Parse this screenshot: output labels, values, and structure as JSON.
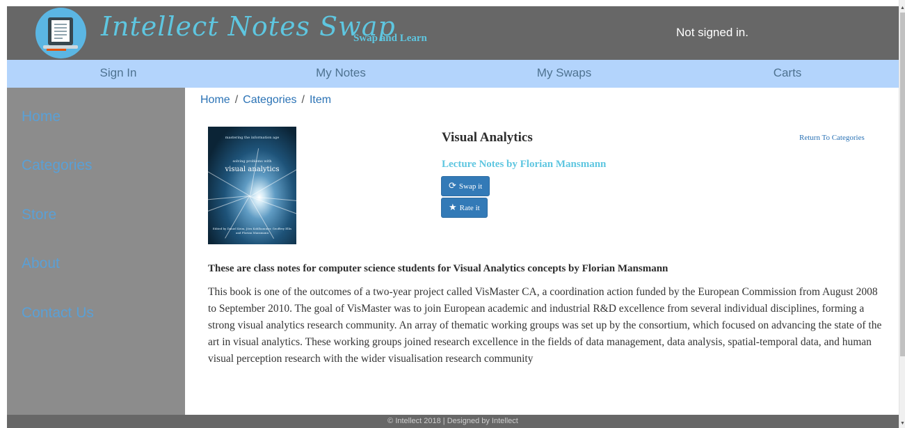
{
  "header": {
    "brand": "Intellect Notes Swap",
    "tagline": "Swap and Learn",
    "signin_status": "Not signed in."
  },
  "nav": {
    "items": [
      {
        "label": "Sign In"
      },
      {
        "label": "My Notes"
      },
      {
        "label": "My Swaps"
      },
      {
        "label": "Carts"
      }
    ]
  },
  "sidebar": {
    "items": [
      {
        "label": "Home"
      },
      {
        "label": "Categories"
      },
      {
        "label": "Store"
      },
      {
        "label": "About"
      },
      {
        "label": "Contact Us"
      }
    ]
  },
  "breadcrumb": {
    "items": [
      "Home",
      "Categories",
      "Item"
    ],
    "separator": "/"
  },
  "cover": {
    "top_text": "mastering the information age",
    "subtitle": "solving problems with",
    "title": "visual analytics",
    "editors": "Edited by Daniel Keim, Jörn Kohlhammer, Geoffrey Ellis and Florian Mansmann"
  },
  "item": {
    "title": "Visual Analytics",
    "return_label": "Return To Categories",
    "author": "Lecture Notes by Florian Mansmann",
    "swap_label": "Swap it",
    "swap_icon": "refresh-icon",
    "rate_label": "Rate it",
    "rate_icon": "star-icon"
  },
  "description": {
    "heading": "These are class notes for computer science students for Visual Analytics concepts by Florian Mansmann",
    "body": "This book is one of the outcomes of a two-year project called VisMaster CA, a coordination action funded by the European Commission from August 2008 to September 2010. The goal of VisMaster was to join European academic and industrial R&D excellence from several individual disciplines, forming a strong visual analytics research community. An array of thematic working groups was set up by the consortium, which focused on advancing the state of the art in visual analytics. These working groups joined research excellence in the fields of data management, data analysis, spatial-temporal data, and human visual perception research with the wider visualisation research community"
  },
  "footer": {
    "text": "© Intellect 2018 | Designed by Intellect"
  },
  "colors": {
    "header_bg": "#676767",
    "nav_bg": "#b3d4fc",
    "sidebar_bg": "#8c8c8c",
    "brand": "#5ec6e0",
    "link": "#2a72b5",
    "button": "#337ab7"
  }
}
